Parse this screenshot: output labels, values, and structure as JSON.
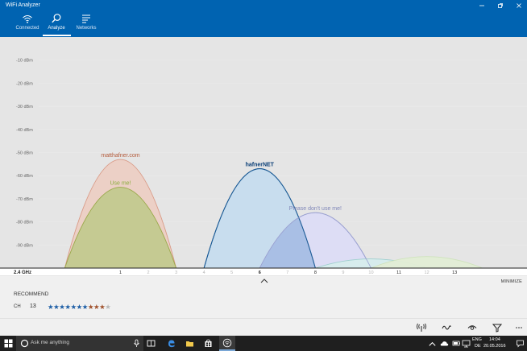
{
  "window": {
    "title": "WiFi Analyzer",
    "controls": [
      "minimize",
      "maximize",
      "close"
    ]
  },
  "nav": [
    {
      "label": "Connected",
      "icon": "wifi-icon",
      "active": false
    },
    {
      "label": "Analyze",
      "icon": "analyze-search-icon",
      "active": true
    },
    {
      "label": "Networks",
      "icon": "networks-list-icon",
      "active": false
    }
  ],
  "chart_data": {
    "type": "area",
    "band_label": "2.4 GHz",
    "y_ticks": [
      "-10 dBm",
      "-20 dBm",
      "-30 dBm",
      "-40 dBm",
      "-50 dBm",
      "-60 dBm",
      "-70 dBm",
      "-80 dBm",
      "-90 dBm"
    ],
    "y_tick_values": [
      -10,
      -20,
      -30,
      -40,
      -50,
      -60,
      -70,
      -80,
      -90
    ],
    "ylim": [
      -100,
      0
    ],
    "x_ticks": [
      "1",
      "2",
      "3",
      "4",
      "5",
      "6",
      "7",
      "8",
      "9",
      "10",
      "11",
      "12",
      "13"
    ],
    "x_tick_values": [
      1,
      2,
      3,
      4,
      5,
      6,
      7,
      8,
      9,
      10,
      11,
      12,
      13
    ],
    "highlighted_channels": [
      1,
      6,
      8,
      11,
      13
    ],
    "xlim": [
      -2.4,
      15.6
    ],
    "networks": [
      {
        "name": "matthafner.com",
        "channel": 1,
        "signal_dbm": -53,
        "label_color": "#b35a3a",
        "fill": "#eccfc4",
        "stroke": "#d99a86",
        "label_bold": false
      },
      {
        "name": "Use me!",
        "channel": 1,
        "signal_dbm": -65,
        "label_color": "#8aac3a",
        "fill": "#c3c98f",
        "stroke": "#9aa84a",
        "label_bold": false
      },
      {
        "name": "hafnerNET",
        "channel": 6,
        "signal_dbm": -57,
        "label_color": "#0b3f77",
        "fill": "#c6dcee",
        "stroke": "#1a5a95",
        "label_bold": true
      },
      {
        "name": "Please don't use me!",
        "channel": 8,
        "signal_dbm": -76,
        "label_color": "#7f86b8",
        "fill": "#dcdcf5",
        "stroke": "#9aa0d0",
        "label_bold": false
      },
      {
        "name": "",
        "channel": 10,
        "signal_dbm": -96,
        "label_color": "#70b8b8",
        "fill": "#d6ecec",
        "stroke": "#9fcfcf",
        "label_bold": false
      },
      {
        "name": "",
        "channel": 12,
        "signal_dbm": -95,
        "label_color": "#b7d6a0",
        "fill": "#e2edd5",
        "stroke": "#cfe3bd",
        "label_bold": false
      }
    ],
    "overlap_fill": "#a9bfe5"
  },
  "panel": {
    "minimize_label": "MINIMIZE",
    "recommend_label": "RECOMMEND",
    "ch_label": "CH",
    "ch_value": "13",
    "rating": {
      "blue": 7,
      "brown": 3,
      "empty": 1
    },
    "star_colors": {
      "blue": "#1f5fa6",
      "brown": "#a0522d",
      "empty": "#b9b9b9"
    }
  },
  "command_bar": [
    "signal-tower-icon",
    "wave-icon",
    "eye-icon",
    "filter-icon",
    "more-icon"
  ],
  "taskbar": {
    "search_placeholder": "Ask me anything",
    "lang": "ENG",
    "lang_sub": "DE",
    "time": "14:04",
    "date": "20.05.2016"
  }
}
